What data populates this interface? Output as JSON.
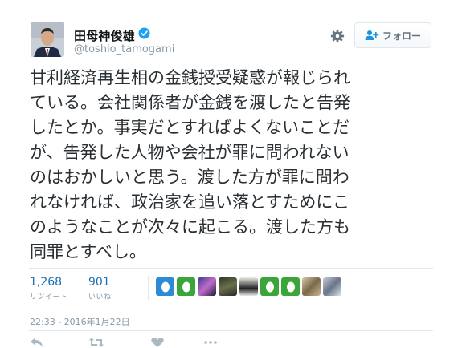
{
  "user": {
    "display_name": "田母神俊雄",
    "handle": "@toshio_tamogami",
    "verified_icon": "verified-badge-icon",
    "avatar": "user-avatar"
  },
  "header": {
    "settings_icon": "gear-icon",
    "follow_label": "フォロー",
    "follow_icon": "add-user-icon"
  },
  "tweet": {
    "text": "甘利経済再生相の金銭授受疑惑が報じられ\nている。会社関係者が金銭を渡したと告発\nしたとか。事実だとすればよくないことだ\nが、告発した人物や会社が罪に問われない\nのはおかしいと思う。渡した方が罪に問わ\nれなければ、政治家を追い落とすためにこ\nのようなことが次々に起こる。渡した方も\n同罪とすべし。"
  },
  "stats": {
    "retweets": {
      "count": "1,268",
      "label": "リツイート"
    },
    "likes": {
      "count": "901",
      "label": "いいね"
    }
  },
  "likers": [
    "egg-avatar-blue",
    "egg-avatar-green",
    "photo-avatar",
    "photo-avatar",
    "photo-avatar",
    "egg-avatar-green",
    "egg-avatar-green",
    "photo-avatar",
    "photo-avatar"
  ],
  "timestamp": "22:33 - 2016年1月22日",
  "actions": [
    "reply-icon",
    "retweet-icon",
    "like-icon",
    "more-icon"
  ],
  "colors": {
    "accent": "#1b6fb0",
    "verified": "#1da1f2",
    "muted": "#8899a6",
    "text": "#292f33"
  }
}
